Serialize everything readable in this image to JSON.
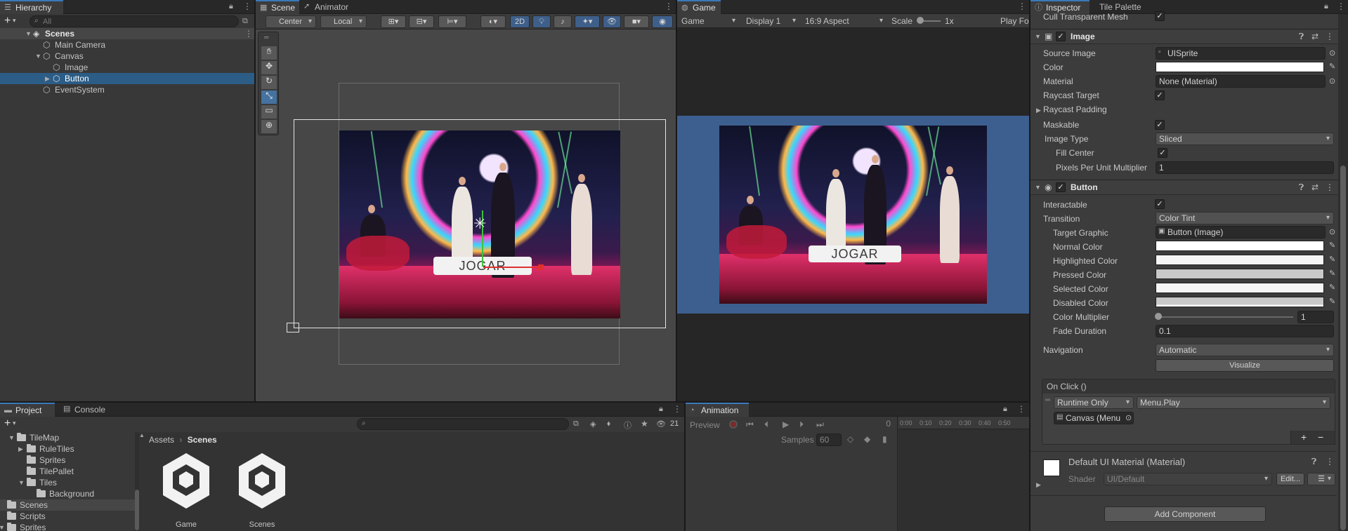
{
  "hierarchy": {
    "tab": "Hierarchy",
    "search_placeholder": "All",
    "items": [
      {
        "label": "Scenes",
        "type": "scene"
      },
      {
        "label": "Main Camera"
      },
      {
        "label": "Canvas"
      },
      {
        "label": "Image"
      },
      {
        "label": "Button"
      },
      {
        "label": "EventSystem"
      }
    ]
  },
  "scene": {
    "tabs": [
      "Scene",
      "Animator"
    ],
    "pivot": "Center",
    "space": "Local",
    "mode_2d": "2D",
    "button_text": "JOGAR"
  },
  "game": {
    "tab": "Game",
    "view": "Game",
    "display": "Display 1",
    "aspect": "16:9 Aspect",
    "scale_label": "Scale",
    "scale_value": "1x",
    "play_focused": "Play Fo",
    "button_text": "JOGAR",
    "bg_color": "#3d5f8f"
  },
  "inspector": {
    "tabs": [
      "Inspector",
      "Tile Palette"
    ],
    "cull_label": "Cull Transparent Mesh",
    "image": {
      "title": "Image",
      "source_image_label": "Source Image",
      "source_image": "UISprite",
      "color_label": "Color",
      "material_label": "Material",
      "material": "None (Material)",
      "raycast_target_label": "Raycast Target",
      "raycast_padding_label": "Raycast Padding",
      "maskable_label": "Maskable",
      "image_type_label": "Image Type",
      "image_type": "Sliced",
      "fill_center_label": "Fill Center",
      "ppu_label": "Pixels Per Unit Multiplier",
      "ppu": "1"
    },
    "button": {
      "title": "Button",
      "interactable_label": "Interactable",
      "transition_label": "Transition",
      "transition": "Color Tint",
      "target_graphic_label": "Target Graphic",
      "target_graphic": "Button (Image)",
      "normal_label": "Normal Color",
      "highlighted_label": "Highlighted Color",
      "pressed_label": "Pressed Color",
      "selected_label": "Selected Color",
      "disabled_label": "Disabled Color",
      "multiplier_label": "Color Multiplier",
      "multiplier": "1",
      "fade_label": "Fade Duration",
      "fade": "0.1",
      "navigation_label": "Navigation",
      "navigation": "Automatic",
      "visualize": "Visualize",
      "onclick_title": "On Click ()",
      "runtime": "Runtime Only",
      "function": "Menu.Play",
      "target_object": "Canvas (Menu"
    },
    "material": {
      "title": "Default UI Material (Material)",
      "shader_label": "Shader",
      "shader": "UI/Default",
      "edit": "Edit..."
    },
    "add_component": "Add Component"
  },
  "project": {
    "tabs": [
      "Project",
      "Console"
    ],
    "tree": [
      {
        "label": "TileMap",
        "indent": 2,
        "open": true
      },
      {
        "label": "RuleTiles",
        "indent": 3
      },
      {
        "label": "Sprites",
        "indent": 3
      },
      {
        "label": "TilePallet",
        "indent": 3
      },
      {
        "label": "Tiles",
        "indent": 3,
        "open": true
      },
      {
        "label": "Background",
        "indent": 4
      },
      {
        "label": "Scenes",
        "indent": 1,
        "selected": true
      },
      {
        "label": "Scripts",
        "indent": 1
      },
      {
        "label": "Sprites",
        "indent": 1,
        "open": true
      }
    ],
    "breadcrumb": [
      "Assets",
      "Scenes"
    ],
    "assets": [
      "Game",
      "Scenes"
    ],
    "hidden_count": "21"
  },
  "animation": {
    "tab": "Animation",
    "preview": "Preview",
    "frame": "0",
    "samples_label": "Samples",
    "samples": "60",
    "timeline": [
      "0:00",
      "0:10",
      "0:20",
      "0:30",
      "0:40",
      "0:50"
    ]
  }
}
